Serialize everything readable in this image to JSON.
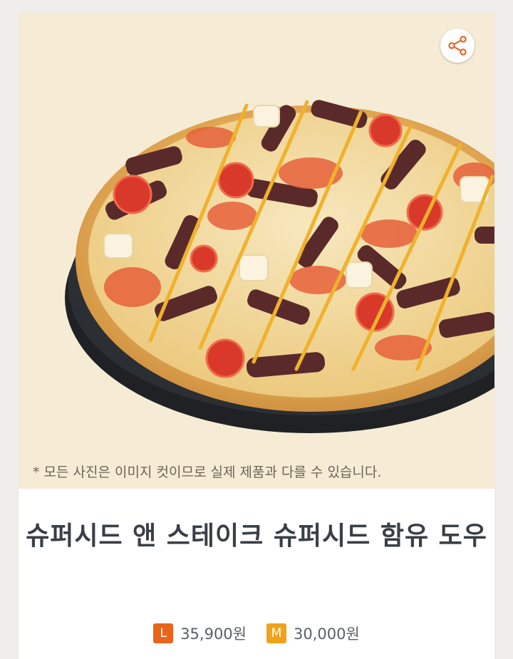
{
  "product": {
    "disclaimer": "* 모든 사진은 이미지 컷이므로 실제 제품과 다를 수 있습니다.",
    "title": "슈퍼시드 앤 스테이크 슈퍼시드 함유 도우",
    "image_alt": "pizza-image"
  },
  "share": {
    "icon": "share-icon"
  },
  "prices": [
    {
      "size": "L",
      "price": "35,900원",
      "color": "#e8651b"
    },
    {
      "size": "M",
      "price": "30,000원",
      "color": "#f0a21b"
    }
  ],
  "colors": {
    "hero_bg": "#f6ecd6",
    "share_icon": "#e8652a",
    "title": "#3a3f46"
  }
}
